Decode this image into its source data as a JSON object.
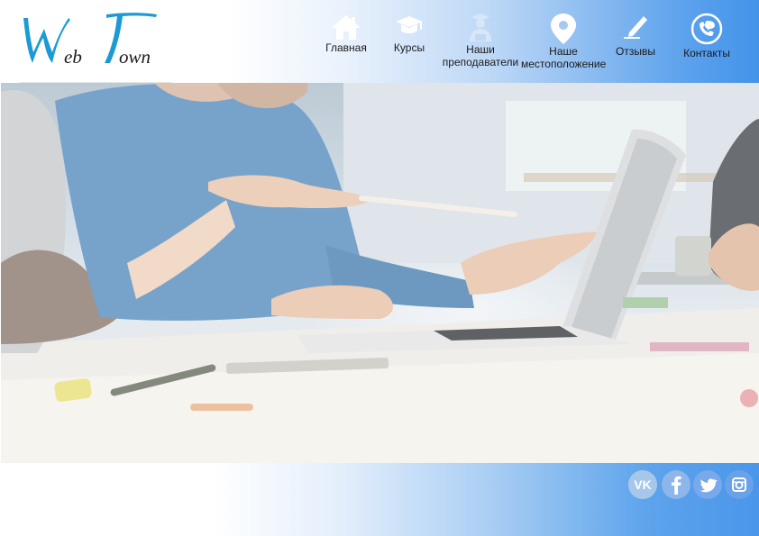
{
  "brand": {
    "logo_text_1": "Web",
    "logo_text_2": "Town",
    "logo_color": "#1b9ad6"
  },
  "nav": {
    "items": [
      {
        "label": "Главная",
        "icon": "home-icon"
      },
      {
        "label": "Курсы",
        "icon": "graduation-cap-icon"
      },
      {
        "label": "Наши\nпреподаватели",
        "icon": "teacher-icon"
      },
      {
        "label": "Наше\nместоположение",
        "icon": "map-pin-icon"
      },
      {
        "label": "Отзывы",
        "icon": "pencil-icon"
      },
      {
        "label": "Контакты",
        "icon": "phone-chat-icon"
      }
    ]
  },
  "hero": {
    "image": "team-working-at-laptop-photo"
  },
  "social": {
    "items": [
      {
        "label": "VK",
        "icon": "vk-icon"
      },
      {
        "label": "f",
        "icon": "facebook-icon"
      },
      {
        "label": "twitter",
        "icon": "twitter-icon"
      },
      {
        "label": "instagram",
        "icon": "instagram-icon"
      }
    ]
  },
  "colors": {
    "accent": "#4393ea",
    "icon_white": "#ffffff",
    "social_bg": "#a9c9ee"
  }
}
